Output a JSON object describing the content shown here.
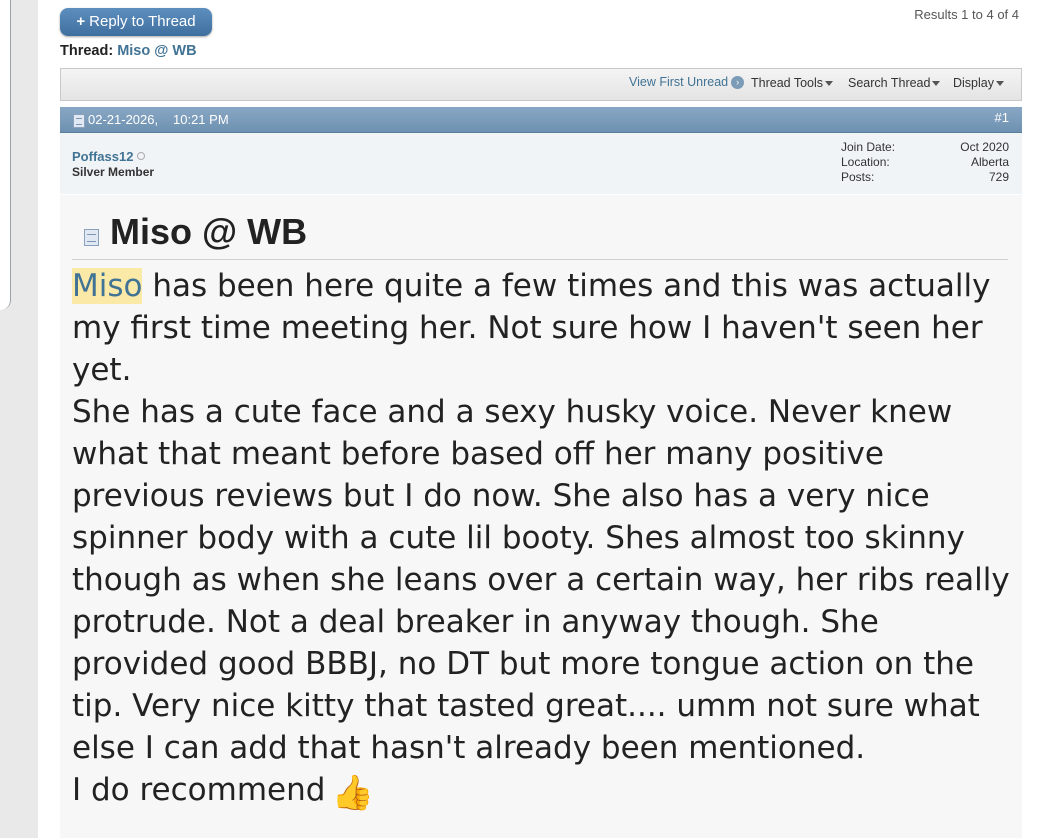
{
  "toolbar_top": {
    "reply_plus": "+",
    "reply_label": "Reply to Thread",
    "results": "Results 1 to 4 of 4"
  },
  "thread": {
    "prefix": "Thread:",
    "title": "Miso @ WB"
  },
  "thread_tools": {
    "view_first_unread": "View First Unread",
    "thread_tools": "Thread Tools",
    "search_thread": "Search Thread",
    "display": "Display"
  },
  "post": {
    "date": "02-21-2026,",
    "time": "10:21 PM",
    "number": "#1",
    "username": "Poffass12",
    "usertitle": "Silver Member",
    "stats": {
      "join_label": "Join Date:",
      "join_value": "Oct 2020",
      "location_label": "Location:",
      "location_value": "Alberta",
      "posts_label": "Posts:",
      "posts_value": "729"
    },
    "title": "Miso @ WB",
    "highlight_word": "Miso",
    "paragraph1_rest": " has been here quite a few times and this was actually my first time meeting her. Not sure how I haven't seen her yet.",
    "paragraph2": "She has a cute face and a sexy husky voice. Never knew what that meant before based off her many positive previous reviews but I do now. She also has a very nice spinner body with a cute lil booty. Shes almost too skinny though as when she leans over a certain way, her ribs really protrude. Not a deal breaker in anyway though. She provided good BBBJ, no DT but more tongue action on the tip. Very nice kitty that tasted great.... umm not sure what else I can add that hasn't already been mentioned.",
    "paragraph3": "I do recommend",
    "emoji": "👍"
  },
  "icons": {
    "post_icon": "post-icon",
    "offline_icon": "offline-status-icon",
    "thumbs_up": "thumbs-up-icon"
  }
}
